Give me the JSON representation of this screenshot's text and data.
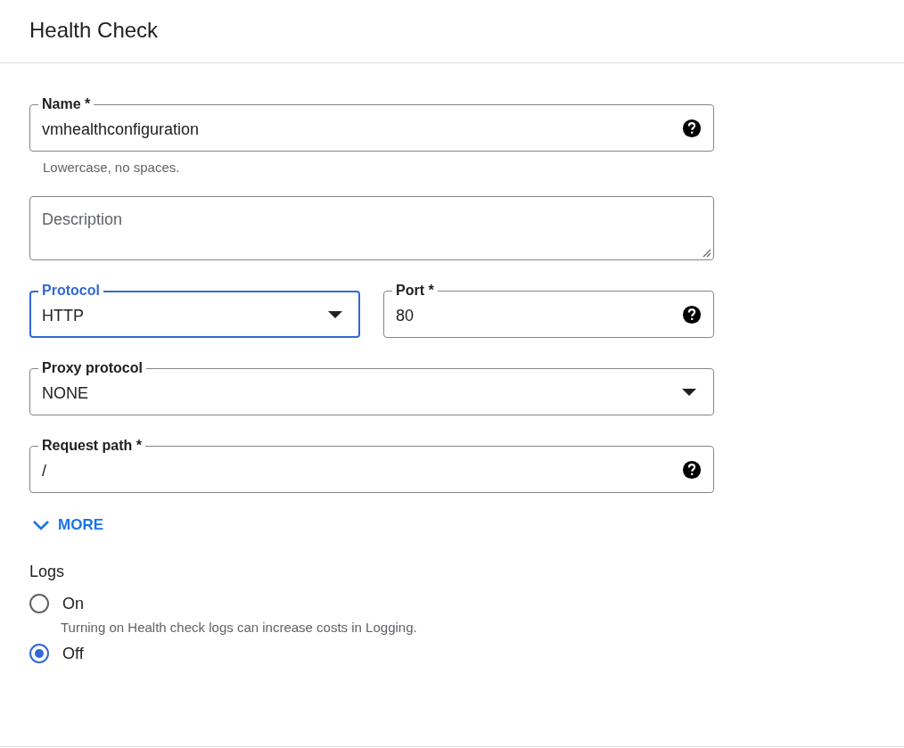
{
  "header": {
    "title": "Health Check"
  },
  "rows": [
    [
      {
        "kind": "text",
        "label": "Name *",
        "value": "vmhealthconfiguration",
        "help_icon": true,
        "hint": "Lowercase, no spaces.",
        "focused": false
      }
    ],
    [
      {
        "kind": "textarea",
        "placeholder": "Description",
        "focused": false
      }
    ],
    [
      {
        "kind": "select",
        "label": "Protocol",
        "value": "HTTP",
        "focused": true
      },
      {
        "kind": "text",
        "label": "Port *",
        "value": "80",
        "help_icon": true,
        "focused": false
      }
    ],
    [
      {
        "kind": "select",
        "label": "Proxy protocol",
        "value": "NONE",
        "focused": false
      }
    ],
    [
      {
        "kind": "text",
        "label": "Request path *",
        "value": "/",
        "help_icon": true,
        "focused": false
      }
    ]
  ],
  "more": {
    "label": "MORE",
    "expanded": false
  },
  "logs": {
    "title": "Logs",
    "options": [
      {
        "label": "On",
        "selected": false,
        "note": "Turning on Health check logs can increase costs in Logging."
      },
      {
        "label": "Off",
        "selected": true
      }
    ]
  }
}
